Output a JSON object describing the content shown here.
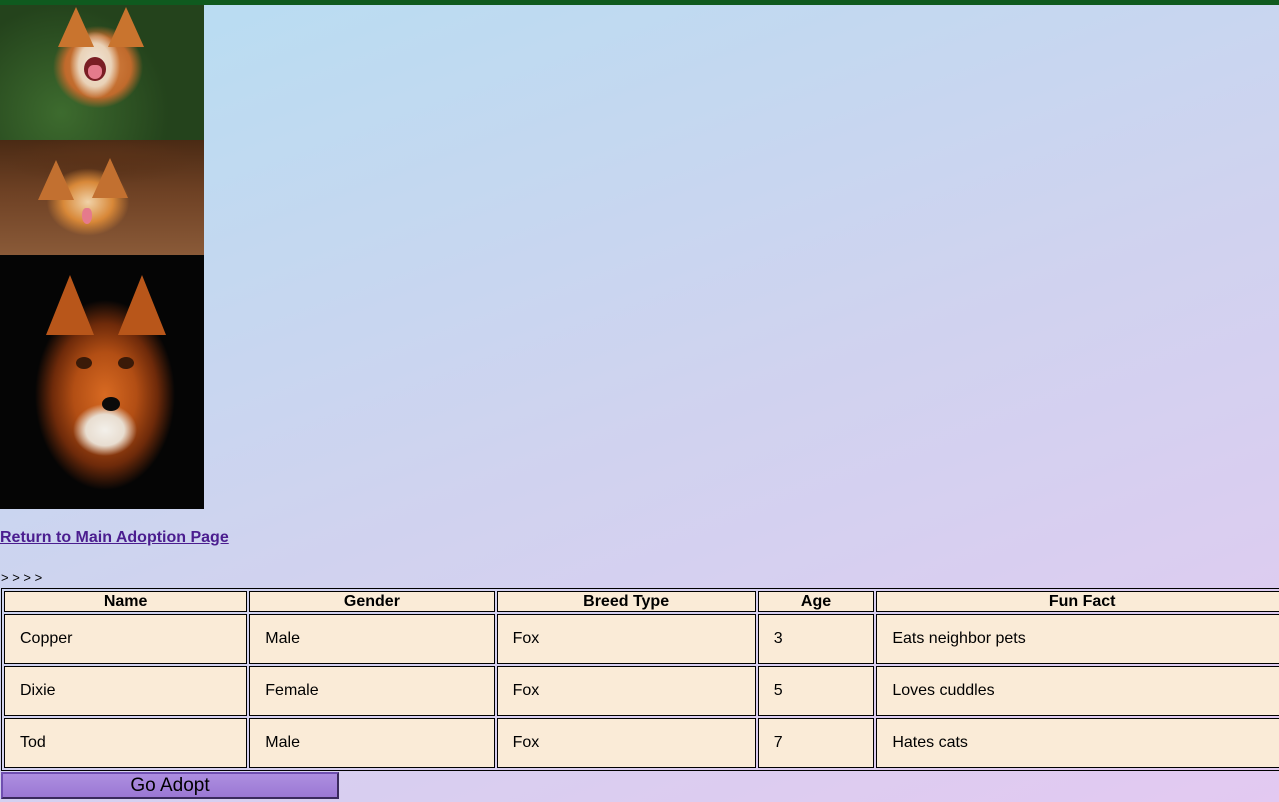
{
  "images": [
    {
      "name": "laughing-fox-photo"
    },
    {
      "name": "fox-tongue-photo"
    },
    {
      "name": "fox-portrait-photo"
    }
  ],
  "links": {
    "return_main": "Return to Main Adoption Page"
  },
  "breadcrumb_marks": "> > > >",
  "table": {
    "headers": [
      "Name",
      "Gender",
      "Breed Type",
      "Age",
      "Fun Fact"
    ],
    "rows": [
      [
        "Copper",
        "Male",
        "Fox",
        "3",
        "Eats neighbor pets"
      ],
      [
        "Dixie",
        "Female",
        "Fox",
        "5",
        "Loves cuddles"
      ],
      [
        "Tod",
        "Male",
        "Fox",
        "7",
        "Hates cats"
      ]
    ]
  },
  "buttons": {
    "go_adopt": "Go Adopt"
  },
  "colors": {
    "top_bar": "#0f5a1f",
    "table_cell_bg": "#faebd7",
    "link": "#4b1d8f",
    "button": "#9b78d4"
  }
}
